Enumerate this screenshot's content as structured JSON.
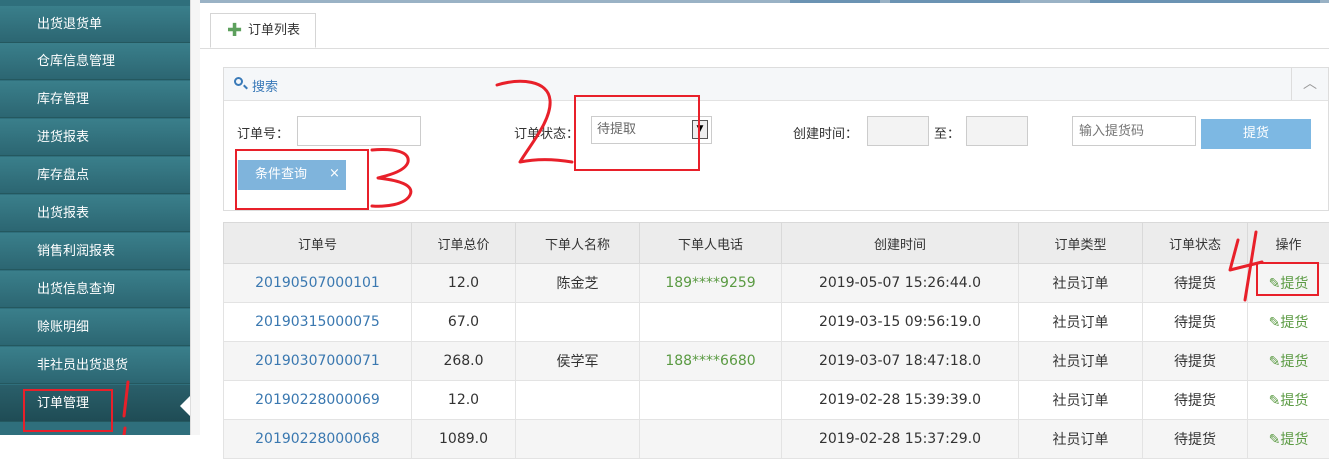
{
  "sidebar": {
    "items": [
      {
        "label": "出货退货单"
      },
      {
        "label": "仓库信息管理"
      },
      {
        "label": "库存管理"
      },
      {
        "label": "进货报表"
      },
      {
        "label": "库存盘点"
      },
      {
        "label": "出货报表"
      },
      {
        "label": "销售利润报表"
      },
      {
        "label": "出货信息查询"
      },
      {
        "label": "赊账明细"
      },
      {
        "label": "非社员出货退货"
      },
      {
        "label": "订单管理",
        "active": true
      }
    ]
  },
  "tab": {
    "label": "订单列表",
    "icon": "plus-icon"
  },
  "search": {
    "title": "搜索",
    "order_no_label": "订单号：",
    "order_no_value": "",
    "status_label": "订单状态：",
    "status_value": "待提取",
    "created_label": "创建时间：",
    "to_label": "至：",
    "pickup_placeholder": "输入提货码",
    "pickup_button": "提货",
    "chip_label": "条件查询",
    "chip_close": "×"
  },
  "table": {
    "headers": [
      "订单号",
      "订单总价",
      "下单人名称",
      "下单人电话",
      "创建时间",
      "订单类型",
      "订单状态",
      "操作"
    ],
    "rows": [
      {
        "id": "20190507000101",
        "total": "12.0",
        "name": "陈金芝",
        "phone": "189****9259",
        "created": "2019-05-07 15:26:44.0",
        "type": "社员订单",
        "status": "待提货",
        "action": "提货"
      },
      {
        "id": "20190315000075",
        "total": "67.0",
        "name": "",
        "phone": "",
        "created": "2019-03-15 09:56:19.0",
        "type": "社员订单",
        "status": "待提货",
        "action": "提货"
      },
      {
        "id": "20190307000071",
        "total": "268.0",
        "name": "侯学军",
        "phone": "188****6680",
        "created": "2019-03-07 18:47:18.0",
        "type": "社员订单",
        "status": "待提货",
        "action": "提货"
      },
      {
        "id": "20190228000069",
        "total": "12.0",
        "name": "",
        "phone": "",
        "created": "2019-02-28 15:39:39.0",
        "type": "社员订单",
        "status": "待提货",
        "action": "提货"
      },
      {
        "id": "20190228000068",
        "total": "1089.0",
        "name": "",
        "phone": "",
        "created": "2019-02-28 15:37:29.0",
        "type": "社员订单",
        "status": "待提货",
        "action": "提货"
      }
    ]
  },
  "colors": {
    "sidebar": "#2f6f7c",
    "accent": "#3a7ab8",
    "phone": "#5a9a42",
    "annotation": "#e8202a"
  }
}
